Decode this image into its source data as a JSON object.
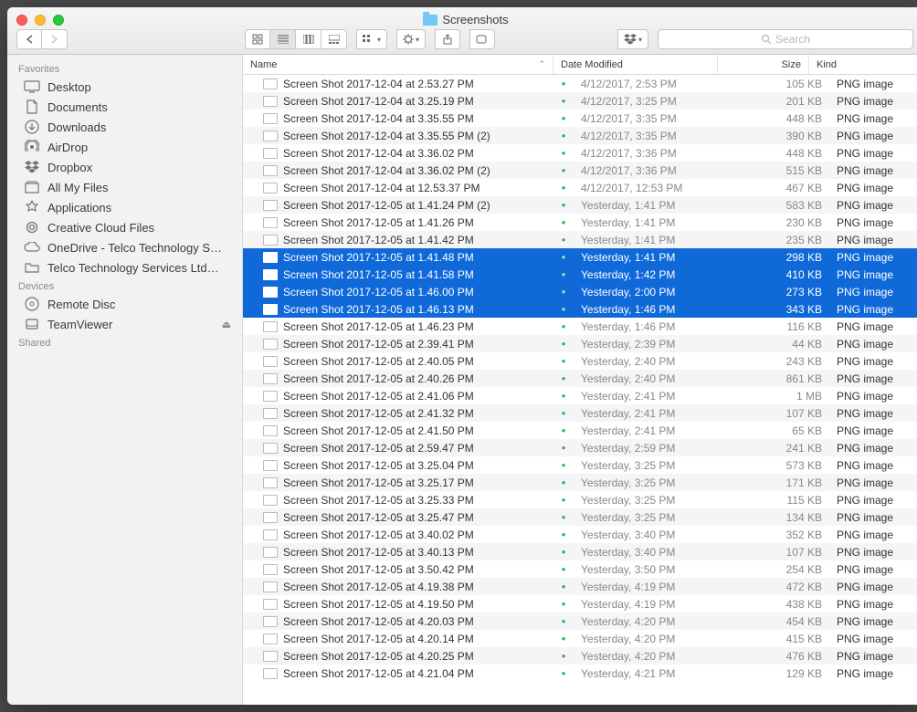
{
  "window": {
    "title": "Screenshots"
  },
  "search": {
    "placeholder": "Search"
  },
  "sidebar": {
    "sections": [
      {
        "title": "Favorites",
        "items": [
          {
            "icon": "desktop",
            "label": "Desktop"
          },
          {
            "icon": "documents",
            "label": "Documents"
          },
          {
            "icon": "downloads",
            "label": "Downloads"
          },
          {
            "icon": "airdrop",
            "label": "AirDrop"
          },
          {
            "icon": "dropbox",
            "label": "Dropbox"
          },
          {
            "icon": "allfiles",
            "label": "All My Files"
          },
          {
            "icon": "apps",
            "label": "Applications"
          },
          {
            "icon": "cloud",
            "label": "Creative Cloud Files"
          },
          {
            "icon": "onedrive",
            "label": "OneDrive - Telco Technology S…"
          },
          {
            "icon": "folder",
            "label": "Telco Technology Services Ltd…"
          }
        ]
      },
      {
        "title": "Devices",
        "items": [
          {
            "icon": "disc",
            "label": "Remote Disc"
          },
          {
            "icon": "drive",
            "label": "TeamViewer",
            "eject": true
          }
        ]
      },
      {
        "title": "Shared",
        "items": []
      }
    ]
  },
  "columns": {
    "name": "Name",
    "modified": "Date Modified",
    "size": "Size",
    "kind": "Kind"
  },
  "files": [
    {
      "name": "Screen Shot 2017-12-04 at 2.53.27 PM",
      "modified": "4/12/2017, 2:53 PM",
      "size": "105 KB",
      "kind": "PNG image",
      "selected": false
    },
    {
      "name": "Screen Shot 2017-12-04 at 3.25.19 PM",
      "modified": "4/12/2017, 3:25 PM",
      "size": "201 KB",
      "kind": "PNG image",
      "selected": false
    },
    {
      "name": "Screen Shot 2017-12-04 at 3.35.55 PM",
      "modified": "4/12/2017, 3:35 PM",
      "size": "448 KB",
      "kind": "PNG image",
      "selected": false
    },
    {
      "name": "Screen Shot 2017-12-04 at 3.35.55 PM (2)",
      "modified": "4/12/2017, 3:35 PM",
      "size": "390 KB",
      "kind": "PNG image",
      "selected": false
    },
    {
      "name": "Screen Shot 2017-12-04 at 3.36.02 PM",
      "modified": "4/12/2017, 3:36 PM",
      "size": "448 KB",
      "kind": "PNG image",
      "selected": false
    },
    {
      "name": "Screen Shot 2017-12-04 at 3.36.02 PM (2)",
      "modified": "4/12/2017, 3:36 PM",
      "size": "515 KB",
      "kind": "PNG image",
      "selected": false
    },
    {
      "name": "Screen Shot 2017-12-04 at 12.53.37 PM",
      "modified": "4/12/2017, 12:53 PM",
      "size": "467 KB",
      "kind": "PNG image",
      "selected": false
    },
    {
      "name": "Screen Shot 2017-12-05 at 1.41.24 PM (2)",
      "modified": "Yesterday, 1:41 PM",
      "size": "583 KB",
      "kind": "PNG image",
      "selected": false
    },
    {
      "name": "Screen Shot 2017-12-05 at 1.41.26 PM",
      "modified": "Yesterday, 1:41 PM",
      "size": "230 KB",
      "kind": "PNG image",
      "selected": false
    },
    {
      "name": "Screen Shot 2017-12-05 at 1.41.42 PM",
      "modified": "Yesterday, 1:41 PM",
      "size": "235 KB",
      "kind": "PNG image",
      "selected": false
    },
    {
      "name": "Screen Shot 2017-12-05 at 1.41.48 PM",
      "modified": "Yesterday, 1:41 PM",
      "size": "298 KB",
      "kind": "PNG image",
      "selected": true
    },
    {
      "name": "Screen Shot 2017-12-05 at 1.41.58 PM",
      "modified": "Yesterday, 1:42 PM",
      "size": "410 KB",
      "kind": "PNG image",
      "selected": true
    },
    {
      "name": "Screen Shot 2017-12-05 at 1.46.00 PM",
      "modified": "Yesterday, 2:00 PM",
      "size": "273 KB",
      "kind": "PNG image",
      "selected": true
    },
    {
      "name": "Screen Shot 2017-12-05 at 1.46.13 PM",
      "modified": "Yesterday, 1:46 PM",
      "size": "343 KB",
      "kind": "PNG image",
      "selected": true
    },
    {
      "name": "Screen Shot 2017-12-05 at 1.46.23 PM",
      "modified": "Yesterday, 1:46 PM",
      "size": "116 KB",
      "kind": "PNG image",
      "selected": false
    },
    {
      "name": "Screen Shot 2017-12-05 at 2.39.41 PM",
      "modified": "Yesterday, 2:39 PM",
      "size": "44 KB",
      "kind": "PNG image",
      "selected": false
    },
    {
      "name": "Screen Shot 2017-12-05 at 2.40.05 PM",
      "modified": "Yesterday, 2:40 PM",
      "size": "243 KB",
      "kind": "PNG image",
      "selected": false
    },
    {
      "name": "Screen Shot 2017-12-05 at 2.40.26 PM",
      "modified": "Yesterday, 2:40 PM",
      "size": "861 KB",
      "kind": "PNG image",
      "selected": false
    },
    {
      "name": "Screen Shot 2017-12-05 at 2.41.06 PM",
      "modified": "Yesterday, 2:41 PM",
      "size": "1 MB",
      "kind": "PNG image",
      "selected": false
    },
    {
      "name": "Screen Shot 2017-12-05 at 2.41.32 PM",
      "modified": "Yesterday, 2:41 PM",
      "size": "107 KB",
      "kind": "PNG image",
      "selected": false
    },
    {
      "name": "Screen Shot 2017-12-05 at 2.41.50 PM",
      "modified": "Yesterday, 2:41 PM",
      "size": "65 KB",
      "kind": "PNG image",
      "selected": false
    },
    {
      "name": "Screen Shot 2017-12-05 at 2.59.47 PM",
      "modified": "Yesterday, 2:59 PM",
      "size": "241 KB",
      "kind": "PNG image",
      "selected": false
    },
    {
      "name": "Screen Shot 2017-12-05 at 3.25.04 PM",
      "modified": "Yesterday, 3:25 PM",
      "size": "573 KB",
      "kind": "PNG image",
      "selected": false
    },
    {
      "name": "Screen Shot 2017-12-05 at 3.25.17 PM",
      "modified": "Yesterday, 3:25 PM",
      "size": "171 KB",
      "kind": "PNG image",
      "selected": false
    },
    {
      "name": "Screen Shot 2017-12-05 at 3.25.33 PM",
      "modified": "Yesterday, 3:25 PM",
      "size": "115 KB",
      "kind": "PNG image",
      "selected": false
    },
    {
      "name": "Screen Shot 2017-12-05 at 3.25.47 PM",
      "modified": "Yesterday, 3:25 PM",
      "size": "134 KB",
      "kind": "PNG image",
      "selected": false
    },
    {
      "name": "Screen Shot 2017-12-05 at 3.40.02 PM",
      "modified": "Yesterday, 3:40 PM",
      "size": "352 KB",
      "kind": "PNG image",
      "selected": false
    },
    {
      "name": "Screen Shot 2017-12-05 at 3.40.13 PM",
      "modified": "Yesterday, 3:40 PM",
      "size": "107 KB",
      "kind": "PNG image",
      "selected": false
    },
    {
      "name": "Screen Shot 2017-12-05 at 3.50.42 PM",
      "modified": "Yesterday, 3:50 PM",
      "size": "254 KB",
      "kind": "PNG image",
      "selected": false
    },
    {
      "name": "Screen Shot 2017-12-05 at 4.19.38 PM",
      "modified": "Yesterday, 4:19 PM",
      "size": "472 KB",
      "kind": "PNG image",
      "selected": false
    },
    {
      "name": "Screen Shot 2017-12-05 at 4.19.50 PM",
      "modified": "Yesterday, 4:19 PM",
      "size": "438 KB",
      "kind": "PNG image",
      "selected": false
    },
    {
      "name": "Screen Shot 2017-12-05 at 4.20.03 PM",
      "modified": "Yesterday, 4:20 PM",
      "size": "454 KB",
      "kind": "PNG image",
      "selected": false
    },
    {
      "name": "Screen Shot 2017-12-05 at 4.20.14 PM",
      "modified": "Yesterday, 4:20 PM",
      "size": "415 KB",
      "kind": "PNG image",
      "selected": false
    },
    {
      "name": "Screen Shot 2017-12-05 at 4.20.25 PM",
      "modified": "Yesterday, 4:20 PM",
      "size": "476 KB",
      "kind": "PNG image",
      "selected": false
    },
    {
      "name": "Screen Shot 2017-12-05 at 4.21.04 PM",
      "modified": "Yesterday, 4:21 PM",
      "size": "129 KB",
      "kind": "PNG image",
      "selected": false
    }
  ]
}
